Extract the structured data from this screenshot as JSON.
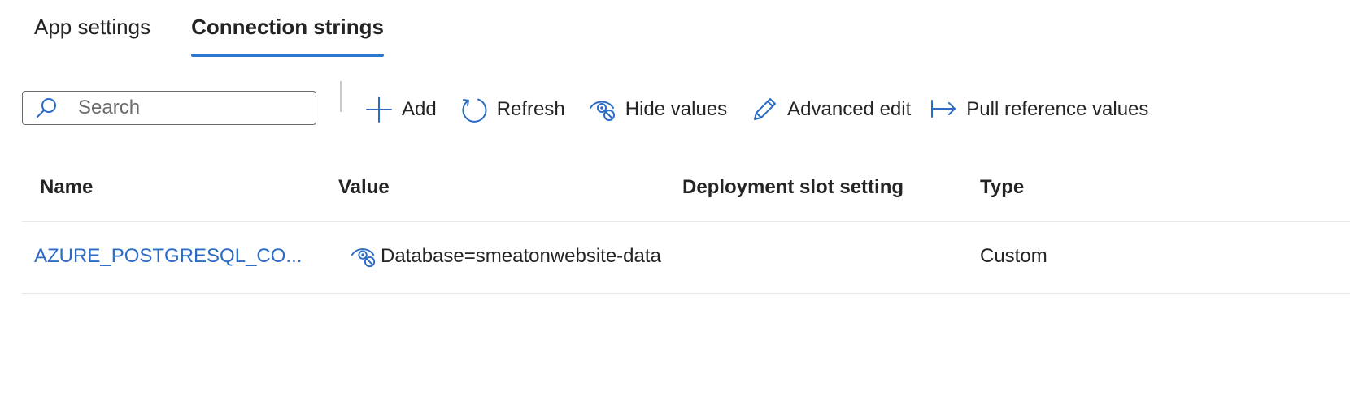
{
  "tabs": [
    {
      "label": "App settings",
      "active": false
    },
    {
      "label": "Connection strings",
      "active": true
    }
  ],
  "search": {
    "placeholder": "Search",
    "value": ""
  },
  "toolbar": {
    "add_label": "Add",
    "refresh_label": "Refresh",
    "hide_values_label": "Hide values",
    "advanced_edit_label": "Advanced edit",
    "pull_reference_label": "Pull reference values"
  },
  "table": {
    "columns": [
      "Name",
      "Value",
      "Deployment slot setting",
      "Type"
    ],
    "rows": [
      {
        "name": "AZURE_POSTGRESQL_CO...",
        "value": "Database=smeatonwebsite-data",
        "deployment_slot_setting": "",
        "type": "Custom"
      }
    ]
  },
  "colors": {
    "accent": "#2b78d0",
    "link": "#2b6cc4",
    "text": "#242424",
    "border": "#e6e6e6"
  },
  "icons": {
    "search": "search-icon",
    "add": "plus-icon",
    "refresh": "refresh-icon",
    "hide_values": "eye-hidden-icon",
    "advanced_edit": "pencil-icon",
    "pull_reference": "arrow-right-bar-icon",
    "value_visibility": "eye-hidden-icon"
  }
}
